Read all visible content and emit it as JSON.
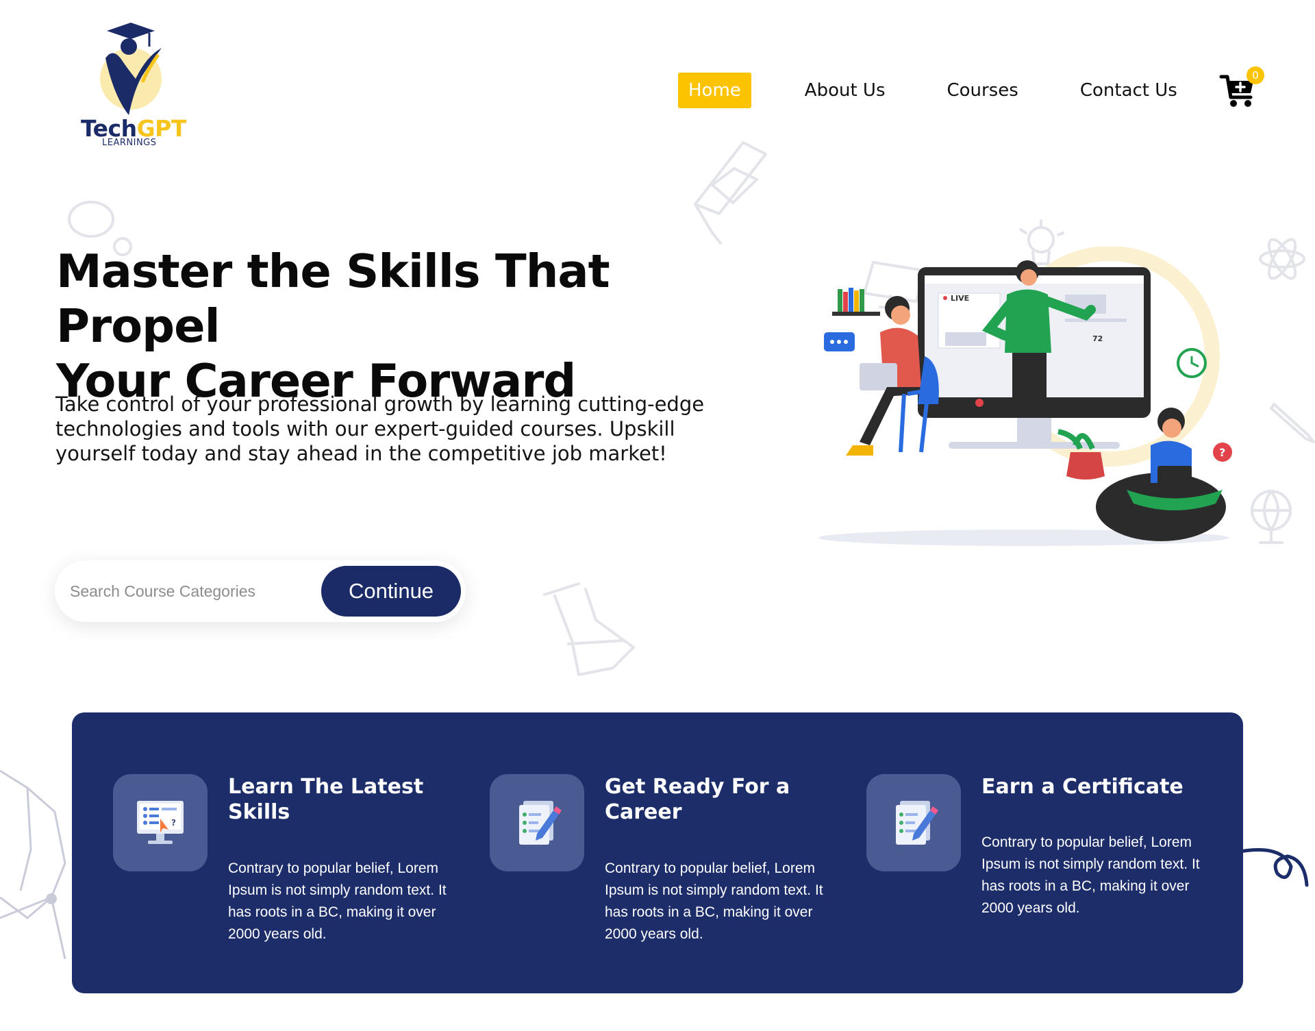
{
  "brand": {
    "name_part1": "Tech",
    "name_part2": "GPT",
    "subtitle": "LEARNINGS",
    "primary_color": "#1b2b67",
    "accent_color": "#fcc400"
  },
  "nav": {
    "items": [
      {
        "label": "Home",
        "active": true
      },
      {
        "label": "About Us"
      },
      {
        "label": "Courses"
      },
      {
        "label": "Contact Us"
      }
    ],
    "cart_icon": "cart-icon",
    "cart_count": "0"
  },
  "hero": {
    "title_line1": "Master the Skills That Propel",
    "title_line2": "Your Career Forward",
    "description": "Take control of your professional growth by learning cutting-edge technologies and tools with our expert-guided courses. Upskill yourself today and stay ahead in the competitive job market!",
    "illustration_labels": {
      "live": "LIVE",
      "viewers": "72"
    }
  },
  "search": {
    "placeholder": "Search Course Categories",
    "button_label": "Continue"
  },
  "features": [
    {
      "icon": "computer-quiz-icon",
      "title": "Learn The Latest Skills",
      "description": "Contrary to popular belief, Lorem Ipsum is not simply random text. It has roots in a BC, making it over 2000 years old."
    },
    {
      "icon": "checklist-pencil-icon",
      "title": "Get Ready For a Career",
      "description": "Contrary to popular belief, Lorem Ipsum is not simply random text. It has roots in a BC, making it over 2000 years old."
    },
    {
      "icon": "checklist-pencil-icon",
      "title": "Earn a Certificate",
      "description": "Contrary to popular belief, Lorem Ipsum is not simply random text. It has roots in a BC, making it over 2000 years old."
    }
  ]
}
